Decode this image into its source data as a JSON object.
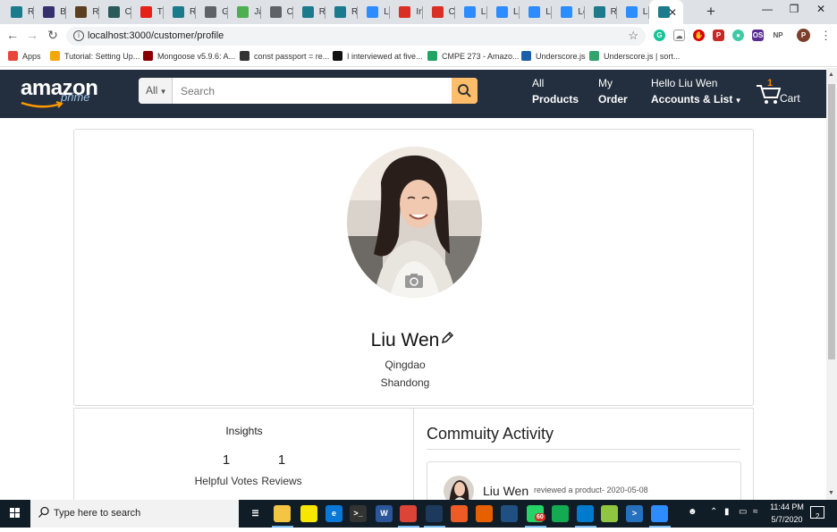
{
  "browser": {
    "tabs": [
      {
        "label": "Re",
        "icon": "react-icon",
        "color": "#1b7a8c"
      },
      {
        "label": "Bo",
        "icon": "bootstrap-icon",
        "color": "#35306e"
      },
      {
        "label": "Re",
        "icon": "redux-icon",
        "color": "#5b3f1e"
      },
      {
        "label": "Cr",
        "icon": "codesandbox-icon",
        "color": "#2b5a5a"
      },
      {
        "label": "Tu",
        "icon": "youtube-icon",
        "color": "#e62117"
      },
      {
        "label": "Re",
        "icon": "react-icon",
        "color": "#1b7a8c"
      },
      {
        "label": "Gr",
        "icon": "globe-icon",
        "color": "#5f6368"
      },
      {
        "label": "Ja",
        "icon": "w3schools-icon",
        "color": "#4caf50"
      },
      {
        "label": "CN",
        "icon": "globe-icon",
        "color": "#5f6368"
      },
      {
        "label": "Re",
        "icon": "react-icon",
        "color": "#1b7a8c"
      },
      {
        "label": "Re",
        "icon": "react-icon",
        "color": "#1b7a8c"
      },
      {
        "label": "La",
        "icon": "zoom-icon",
        "color": "#2d8cff"
      },
      {
        "label": "Int",
        "icon": "gmail-icon",
        "color": "#d93025"
      },
      {
        "label": "Ch",
        "icon": "gmail-icon",
        "color": "#d93025"
      },
      {
        "label": "La",
        "icon": "zoom-icon",
        "color": "#2d8cff"
      },
      {
        "label": "La",
        "icon": "zoom-icon",
        "color": "#2d8cff"
      },
      {
        "label": "La",
        "icon": "zoom-icon",
        "color": "#2d8cff"
      },
      {
        "label": "Lo",
        "icon": "zoom-icon",
        "color": "#2d8cff"
      },
      {
        "label": "Re",
        "icon": "react-icon",
        "color": "#1b7a8c"
      },
      {
        "label": "La",
        "icon": "zoom-icon",
        "color": "#2d8cff"
      },
      {
        "label": "",
        "icon": "react-icon",
        "color": "#1b7a8c"
      }
    ],
    "url": "localhost:3000/customer/profile",
    "profile_initial": "P",
    "bookmarks": [
      {
        "label": "Apps",
        "icon": "apps-grid-icon",
        "color": "#e8453c"
      },
      {
        "label": "Tutorial: Setting Up...",
        "icon": "tutorial-icon",
        "color": "#f4a70b"
      },
      {
        "label": "Mongoose v5.9.6: A...",
        "icon": "mongoose-icon",
        "color": "#880000"
      },
      {
        "label": "const passport = re...",
        "icon": "passport-icon",
        "color": "#333333"
      },
      {
        "label": "I interviewed at five...",
        "icon": "medium-icon",
        "color": "#111111"
      },
      {
        "label": "CMPE 273 - Amazo...",
        "icon": "drive-icon",
        "color": "#1fa463"
      },
      {
        "label": "Underscore.js",
        "icon": "underscore-icon",
        "color": "#1a5faa"
      },
      {
        "label": "Underscore.js | sort...",
        "icon": "dg-icon",
        "color": "#32a36b"
      }
    ]
  },
  "navbar": {
    "logo_main": "amazon",
    "logo_sub": "prime",
    "search_category": "All",
    "search_placeholder": "Search",
    "all_products_line1": "All",
    "all_products_line2": "Products",
    "my_order_line1": "My",
    "my_order_line2": "Order",
    "account_line1": "Hello Liu Wen",
    "account_line2": "Accounts & List",
    "cart_count": "1",
    "cart_label": "Cart",
    "bg_color": "#232f3e",
    "search_btn_color": "#febd69"
  },
  "profile": {
    "name": "Liu Wen",
    "city": "Qingdao",
    "state": "Shandong"
  },
  "insights": {
    "title": "Insights",
    "helpful_votes_count": "1",
    "helpful_votes_label": "Helpful Votes",
    "reviews_count": "1",
    "reviews_label": "Reviews"
  },
  "activity": {
    "title": "Commuity Activity",
    "item_name": "Liu Wen",
    "item_desc": "reviewed a product- 2020-05-08"
  },
  "taskbar": {
    "search_placeholder": "Type here to search",
    "time": "11:44 PM",
    "date": "5/7/2020",
    "notification_count": "2",
    "mail_badge": "60"
  }
}
